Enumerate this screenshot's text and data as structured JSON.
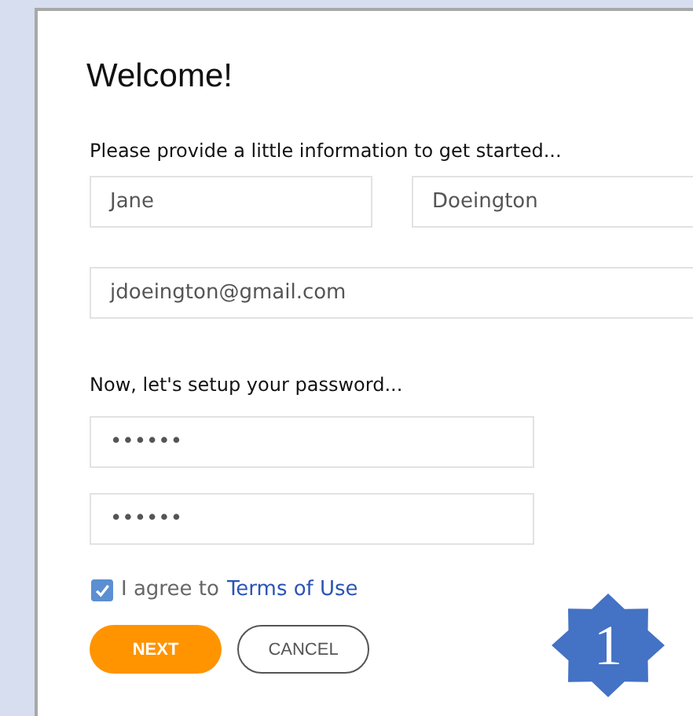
{
  "title": "Welcome!",
  "info_prompt": "Please provide a little information to get started...",
  "name_fields": [
    {
      "value": "Jane"
    },
    {
      "value": "Doeington"
    }
  ],
  "email_field": {
    "value": "jdoeington@gmail.com"
  },
  "password_prompt": "Now, let's setup your password...",
  "password_fields": [
    {
      "value": "••••••"
    },
    {
      "value": "••••••"
    }
  ],
  "agreement": {
    "checked": true,
    "text": "I agree to",
    "link": "Terms of Use"
  },
  "buttons": [
    {
      "label": "NEXT",
      "kind": "primary"
    },
    {
      "label": "CANCEL",
      "kind": "secondary"
    }
  ],
  "step_badge": "1"
}
